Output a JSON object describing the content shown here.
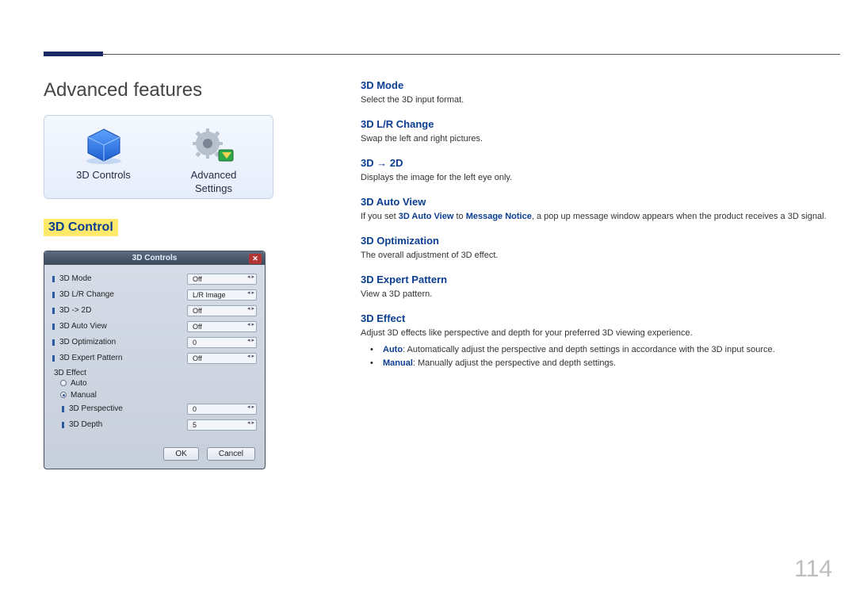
{
  "page": {
    "title": "Advanced features",
    "section": "3D Control",
    "number": "114"
  },
  "icon_panel": {
    "items": [
      {
        "label_line1": "3D Controls",
        "label_line2": ""
      },
      {
        "label_line1": "Advanced",
        "label_line2": "Settings"
      }
    ]
  },
  "dialog": {
    "title": "3D Controls",
    "rows": [
      {
        "label": "3D Mode",
        "value": "Off"
      },
      {
        "label": "3D L/R Change",
        "value": "L/R Image"
      },
      {
        "label": "3D -> 2D",
        "value": "Off"
      },
      {
        "label": "3D Auto View",
        "value": "Off"
      },
      {
        "label": "3D Optimization",
        "value": "0"
      },
      {
        "label": "3D Expert Pattern",
        "value": "Off"
      }
    ],
    "effect_group": {
      "label": "3D Effect",
      "radios": [
        {
          "label": "Auto",
          "selected": false
        },
        {
          "label": "Manual",
          "selected": true
        }
      ],
      "subrows": [
        {
          "label": "3D Perspective",
          "value": "0"
        },
        {
          "label": "3D Depth",
          "value": "5"
        }
      ]
    },
    "buttons": {
      "ok": "OK",
      "cancel": "Cancel"
    }
  },
  "features": {
    "mode": {
      "title": "3D Mode",
      "desc": "Select the 3D input format."
    },
    "lr": {
      "title": "3D L/R Change",
      "desc": "Swap the left and right pictures."
    },
    "to2d": {
      "title": "3D → 2D",
      "desc": "Displays the image for the left eye only."
    },
    "autoview": {
      "title": "3D Auto View",
      "desc_pre": "If you set ",
      "desc_b1": "3D Auto View",
      "desc_mid": " to ",
      "desc_b2": "Message Notice",
      "desc_post": ", a pop up message window appears when the product receives a 3D signal."
    },
    "opt": {
      "title": "3D Optimization",
      "desc": "The overall adjustment of 3D effect."
    },
    "pattern": {
      "title": "3D Expert Pattern",
      "desc": "View a 3D pattern."
    },
    "effect": {
      "title": "3D Effect",
      "desc": "Adjust 3D effects like perspective and depth for your preferred 3D viewing experience.",
      "bullets": [
        {
          "b": "Auto",
          "t": ": Automatically adjust the perspective and depth settings in accordance with the 3D input source."
        },
        {
          "b": "Manual",
          "t": ": Manually adjust the perspective and depth settings."
        }
      ]
    }
  }
}
